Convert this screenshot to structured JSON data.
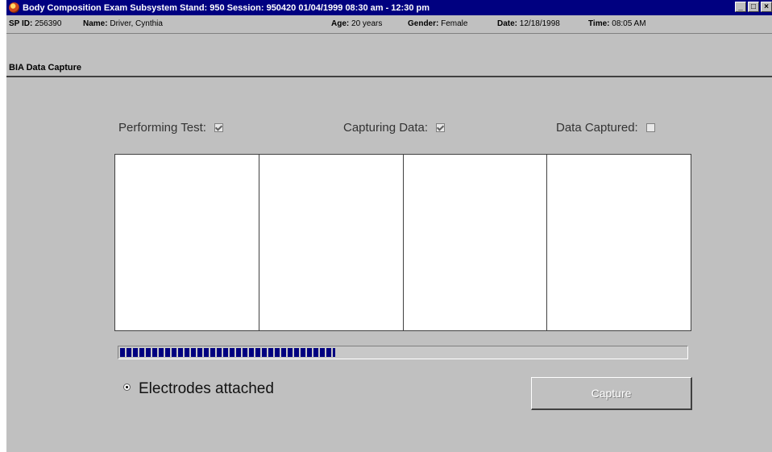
{
  "window": {
    "title": "Body Composition Exam Subsystem  Stand: 950  Session: 950420  01/04/1999  08:30 am - 12:30 pm",
    "buttons": [
      "_",
      "□",
      "×"
    ]
  },
  "info": {
    "sp_id_label": "SP ID:",
    "sp_id": "256390",
    "name_label": "Name:",
    "name": "Driver, Cynthia",
    "age_label": "Age:",
    "age": "20 years",
    "gender_label": "Gender:",
    "gender": "Female",
    "date_label": "Date:",
    "date": "12/18/1998",
    "time_label": "Time:",
    "time": "08:05 AM"
  },
  "section": {
    "title": "BIA Data Capture"
  },
  "status": {
    "performing_test": {
      "label": "Performing Test:",
      "checked": true
    },
    "capturing_data": {
      "label": "Capturing Data:",
      "checked": true
    },
    "data_captured": {
      "label": "Data Captured:",
      "checked": false
    }
  },
  "progress": {
    "percent": 38
  },
  "electrodes": {
    "label": "Electrodes attached",
    "selected": true
  },
  "capture_button": {
    "label": "Capture",
    "enabled": false
  },
  "icons": {
    "app": "app-globe-icon"
  }
}
